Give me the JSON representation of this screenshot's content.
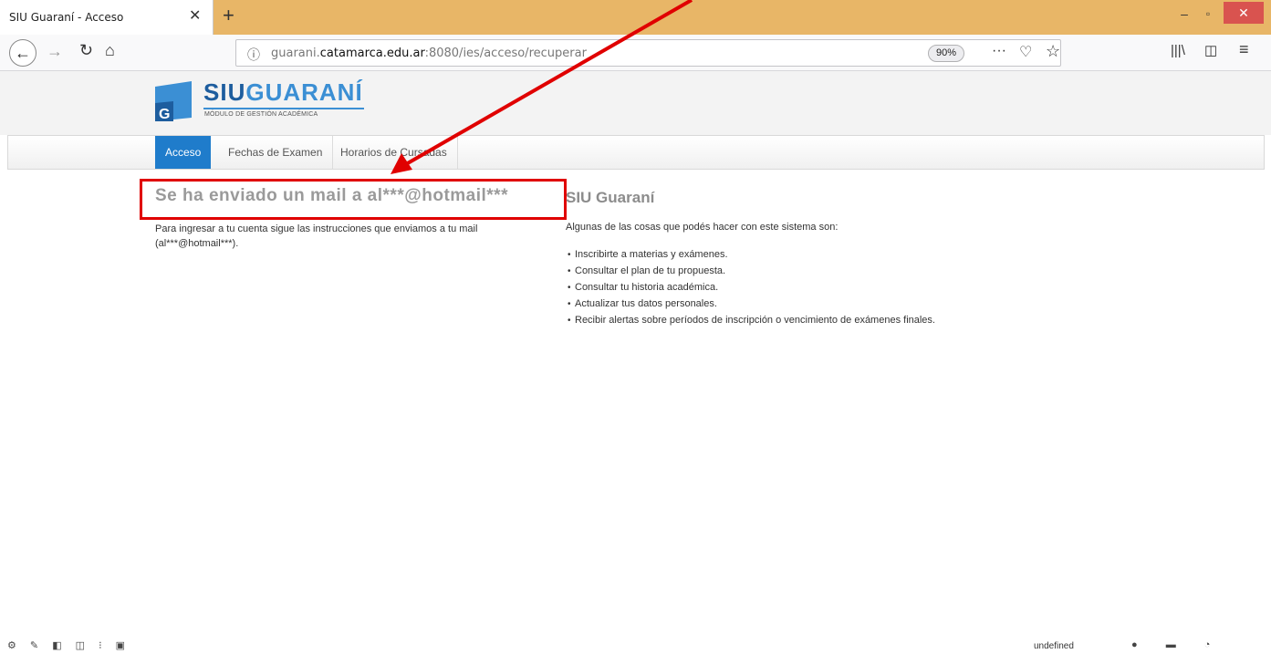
{
  "browser": {
    "tab_title": "SIU Guaraní - Acceso",
    "tab_close": "✕",
    "new_tab": "+",
    "url_prefix": "guarani.",
    "url_domain": "catamarca.edu.ar",
    "url_suffix": ":8080/ies/acceso/recuperar",
    "zoom": "90%",
    "window_controls": {
      "minimize": "–",
      "maximize": "▫",
      "close": "✕"
    }
  },
  "site": {
    "logo_siu": "SIU",
    "logo_guarani": "GUARANÍ",
    "logo_subtitle": "MÓDULO DE GESTIÓN ACADÉMICA",
    "logo_letter": "G"
  },
  "menu": {
    "items": [
      {
        "label": "Acceso"
      },
      {
        "label": "Fechas de Examen"
      },
      {
        "label": "Horarios de Cursadas"
      }
    ]
  },
  "main": {
    "heading": "Se ha enviado un mail a al***@hotmail***",
    "text_line1": "Para ingresar a tu cuenta sigue las instrucciones que enviamos a tu mail",
    "text_line2": "(al***@hotmail***)."
  },
  "aside": {
    "heading": "SIU Guaraní",
    "intro": "Algunas de las cosas que podés hacer con este sistema son:",
    "items": [
      "Inscribirte a materias y exámenes.",
      "Consultar el plan de tu propuesta.",
      "Consultar tu historia académica.",
      "Actualizar tus datos personales.",
      "Recibir alertas sobre períodos de inscripción o vencimiento de exámenes finales."
    ]
  },
  "statusbar": {
    "right_text": "undefined"
  },
  "colors": {
    "tabbar": "#e8b667",
    "menu_active": "#1f7ccb",
    "annotation": "#e00000"
  }
}
